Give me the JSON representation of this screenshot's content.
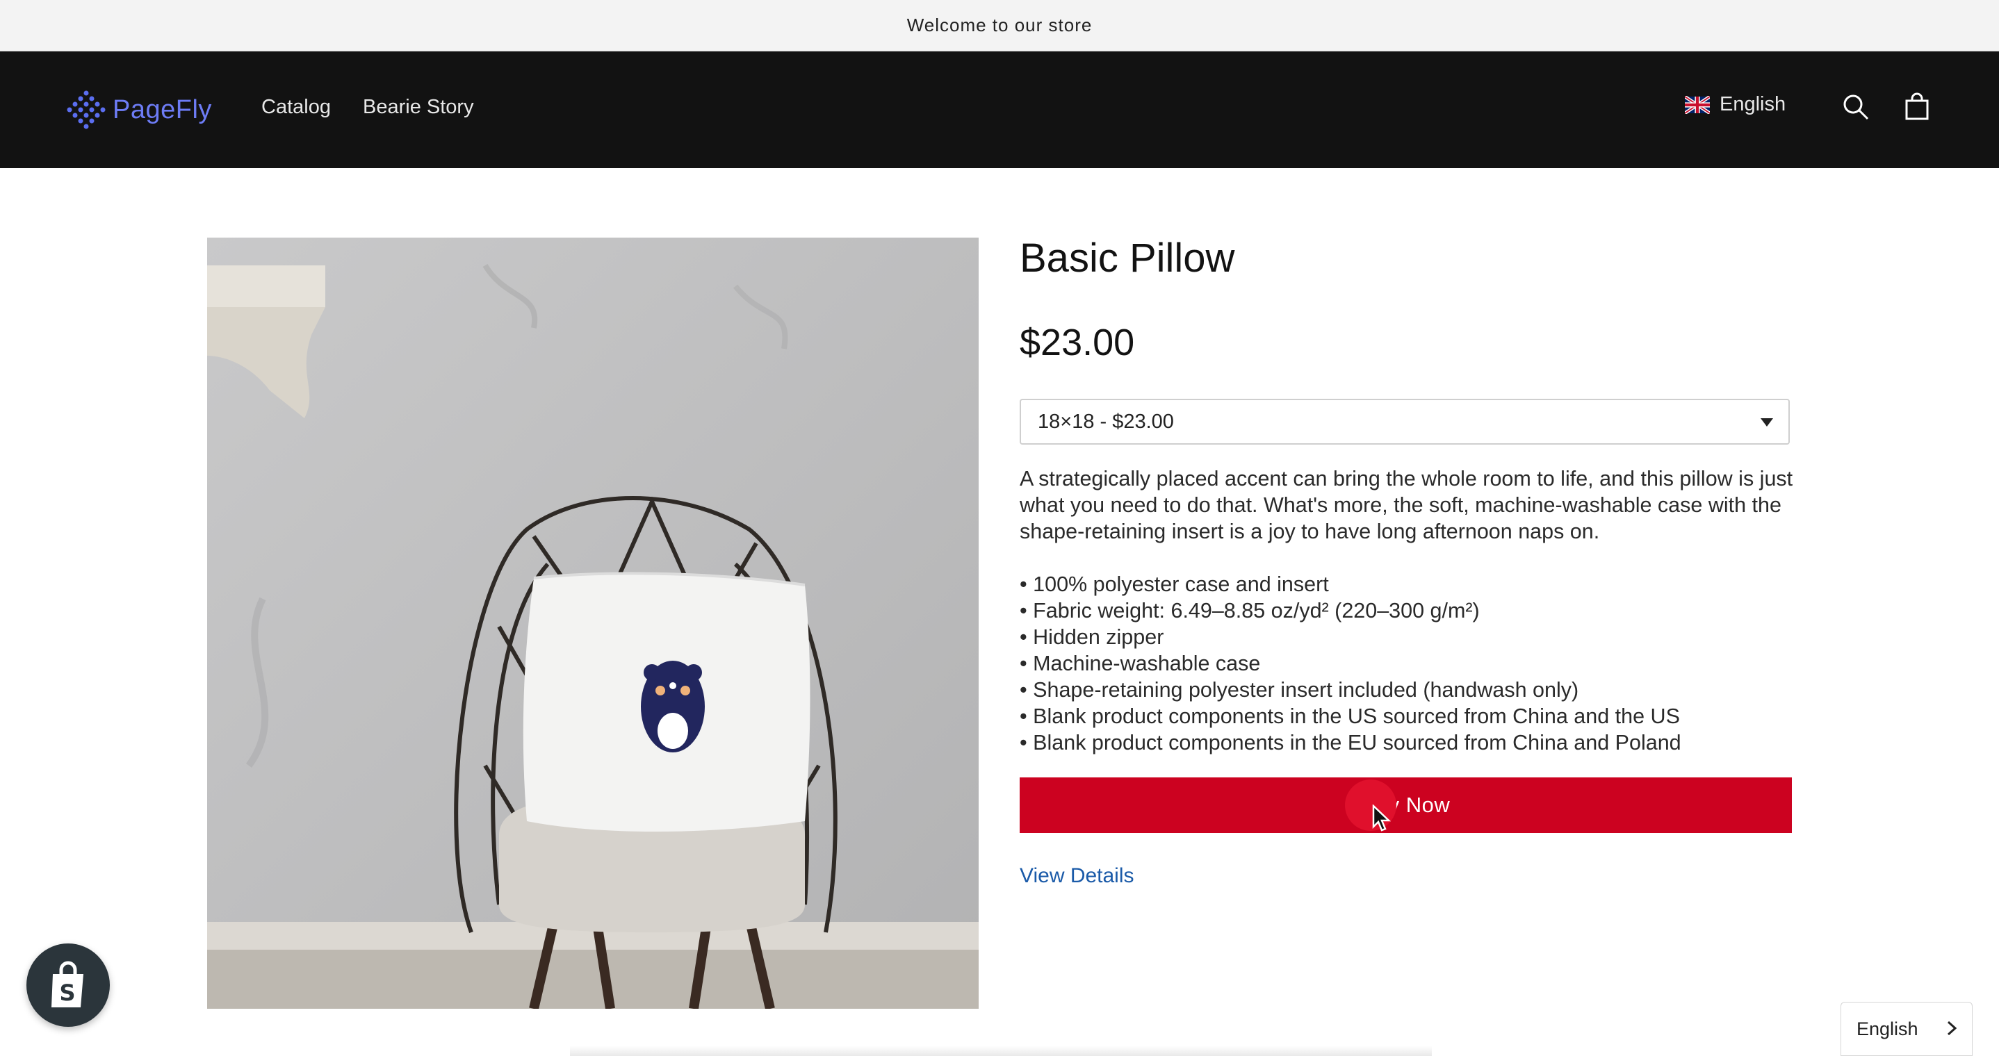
{
  "announcement": "Welcome to our store",
  "header": {
    "logo_text": "PageFly",
    "nav": [
      "Catalog",
      "Bearie Story"
    ],
    "language": "English",
    "icons": [
      "search-icon",
      "cart-icon"
    ]
  },
  "product": {
    "title": "Basic Pillow",
    "price": "$23.00",
    "variant_selected": "18×18 - $23.00",
    "description": "A strategically placed accent can bring the whole room to life, and this pillow is just what you need to do that. What's more, the soft, machine-washable case with the shape-retaining insert is a joy to have long afternoon naps on.",
    "bullets": [
      "• 100% polyester case and insert",
      "• Fabric weight: 6.49–8.85 oz/yd² (220–300 g/m²)",
      "• Hidden zipper",
      "• Machine-washable case",
      "• Shape-retaining polyester insert included (handwash only)",
      "• Blank product components in the US sourced from China and the US",
      "• Blank product components in the EU sourced from China and Poland"
    ],
    "buy_label": "Buy Now",
    "view_details": "View Details"
  },
  "language_widget": "English",
  "colors": {
    "header_bg": "#121212",
    "buy_button": "#cc0220",
    "link": "#1a5aa8",
    "logo": "#6d7cf5"
  }
}
